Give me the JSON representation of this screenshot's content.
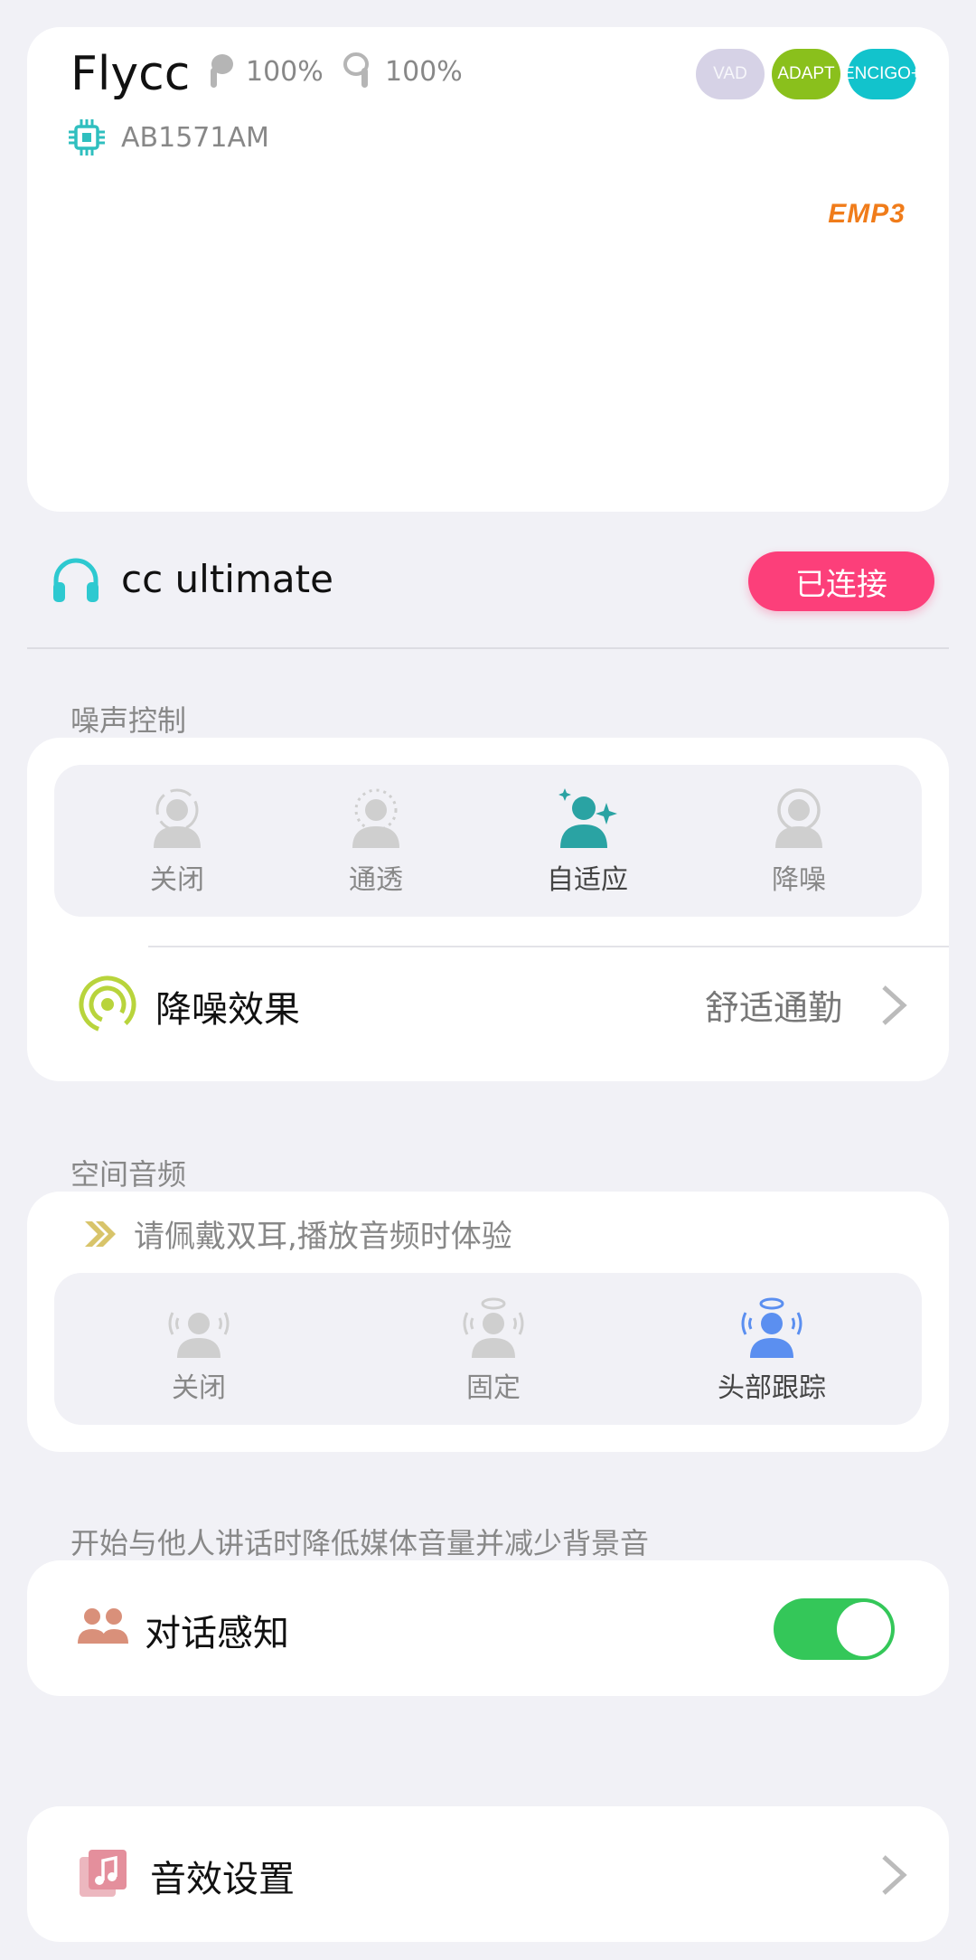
{
  "device": {
    "name": "Flycc",
    "left_battery": "100%",
    "right_battery": "100%",
    "chip": "AB1571AM",
    "badges": {
      "vad": "VAD",
      "adapt": "ADAPT",
      "enc_line1": "ENC",
      "enc_line2": "IGO+"
    },
    "brand": "EMP3"
  },
  "connection": {
    "device_name": "cc ultimate",
    "status_label": "已连接",
    "status_color": "#fc3f7a"
  },
  "noise_control": {
    "section_title": "噪声控制",
    "modes": [
      {
        "label": "关闭",
        "icon": "person-off-icon",
        "selected": false
      },
      {
        "label": "通透",
        "icon": "person-transparency-icon",
        "selected": false
      },
      {
        "label": "自适应",
        "icon": "person-adaptive-icon",
        "selected": true
      },
      {
        "label": "降噪",
        "icon": "person-anc-icon",
        "selected": false
      }
    ],
    "effect": {
      "title": "降噪效果",
      "value": "舒适通勤",
      "icon": "anc-effect-icon"
    }
  },
  "spatial_audio": {
    "section_title": "空间音频",
    "hint": "请佩戴双耳,播放音频时体验",
    "modes": [
      {
        "label": "关闭",
        "icon": "spatial-off-icon",
        "selected": false
      },
      {
        "label": "固定",
        "icon": "spatial-fixed-icon",
        "selected": false
      },
      {
        "label": "头部跟踪",
        "icon": "head-tracking-icon",
        "selected": true
      }
    ]
  },
  "conversation": {
    "section_title": "开始与他人讲话时降低媒体音量并减少背景音",
    "title": "对话感知",
    "enabled": true
  },
  "sound_settings": {
    "title": "音效设置"
  },
  "colors": {
    "accent_teal": "#2aa3a3",
    "accent_blue": "#5b8ff0",
    "toggle_on": "#34c759",
    "anc_icon": "#b8d43c",
    "brand_orange": "#f07c1a"
  }
}
